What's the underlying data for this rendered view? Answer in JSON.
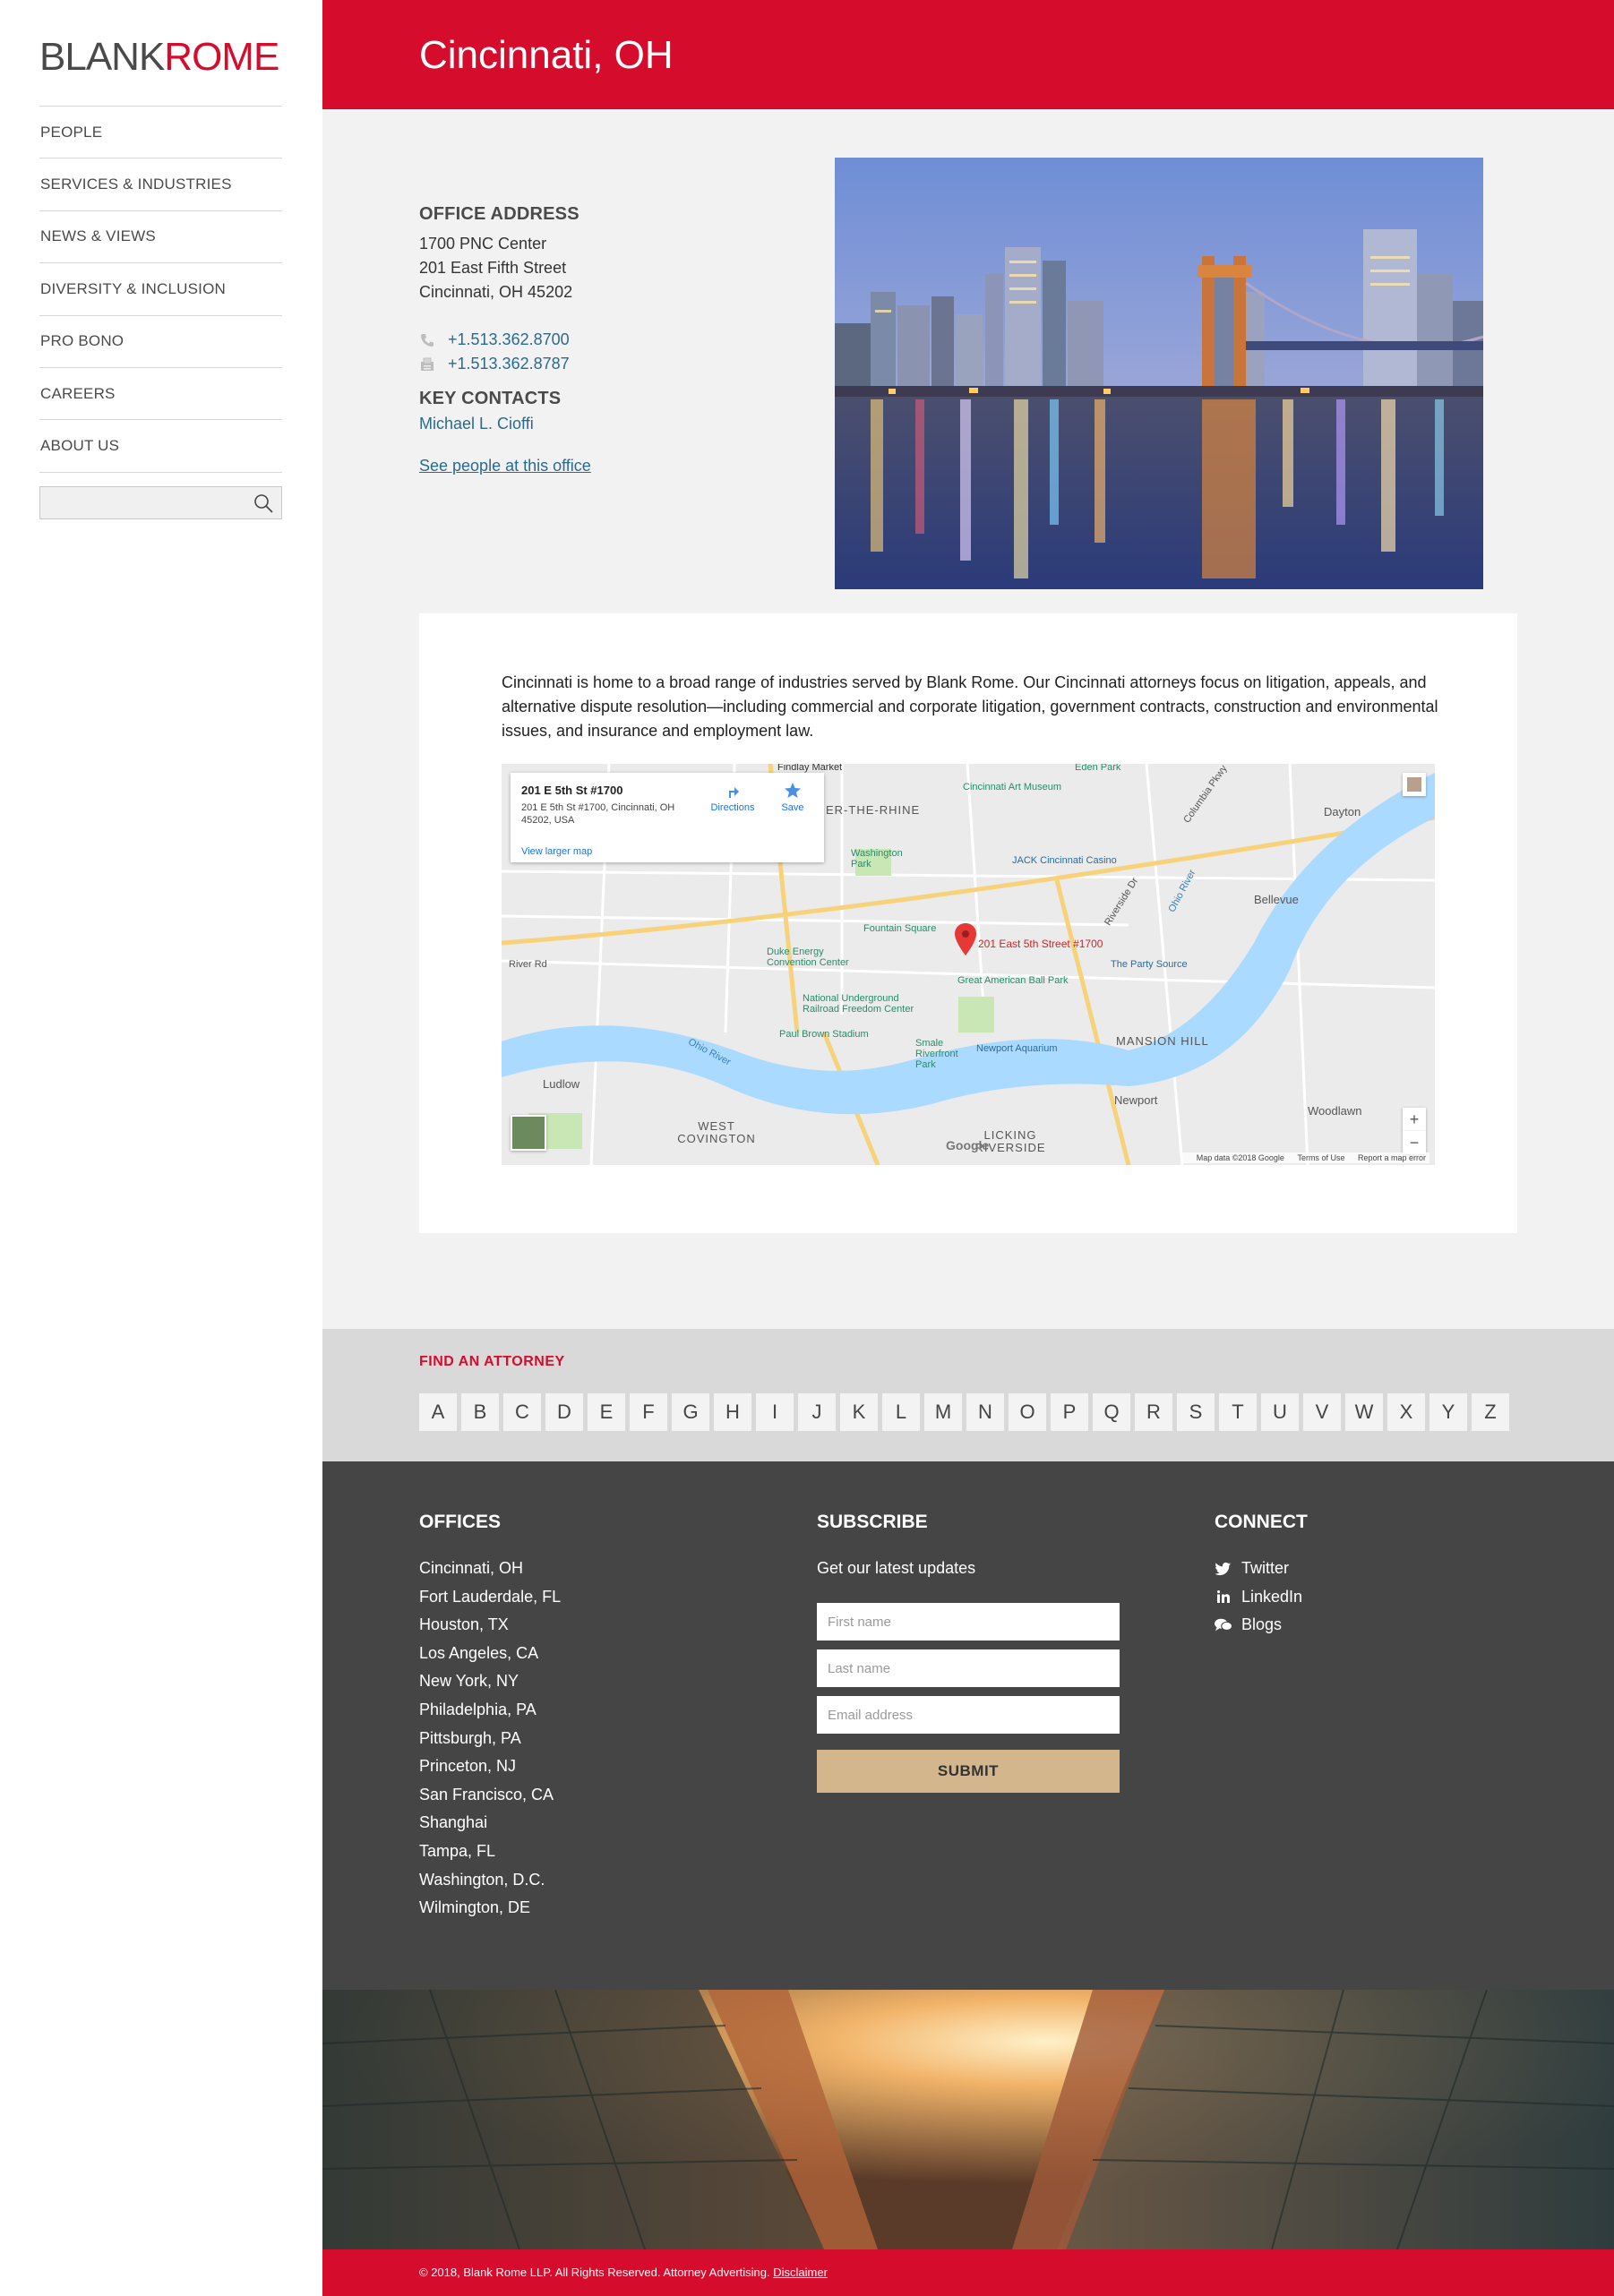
{
  "brand": {
    "part1": "BLANK",
    "part2": "ROME",
    "accent": "#d50c2c"
  },
  "nav": [
    {
      "label": "PEOPLE"
    },
    {
      "label": "SERVICES & INDUSTRIES"
    },
    {
      "label": "NEWS & VIEWS"
    },
    {
      "label": "DIVERSITY & INCLUSION"
    },
    {
      "label": "PRO BONO"
    },
    {
      "label": "CAREERS"
    },
    {
      "label": "ABOUT US"
    }
  ],
  "search": {
    "placeholder": "",
    "icon": "search-icon"
  },
  "page": {
    "title": "Cincinnati, OH"
  },
  "office": {
    "address_heading": "OFFICE ADDRESS",
    "address_lines": [
      "1700 PNC Center",
      "201 East Fifth Street",
      "Cincinnati, OH 45202"
    ],
    "phone": "+1.513.362.8700",
    "fax": "+1.513.362.8787",
    "contacts_heading": "KEY CONTACTS",
    "contact_name": "Michael L. Cioffi",
    "people_link": "See people at this office"
  },
  "description": "Cincinnati is home to a broad range of industries served by Blank Rome. Our Cincinnati attorneys focus on litigation, appeals, and alternative dispute resolution—including commercial and corporate litigation, government contracts, construction and environmental issues, and insurance and employment law.",
  "map": {
    "card_title": "201 E 5th St #1700",
    "card_address": "201 E 5th St #1700, Cincinnati, OH 45202, USA",
    "view_larger": "View larger map",
    "directions": "Directions",
    "save": "Save",
    "pin_label": "201 East 5th Street #1700",
    "google": "Google",
    "map_data": "Map data ©2018 Google",
    "terms": "Terms of Use",
    "report": "Report a map error",
    "labels": {
      "findlay": "Findlay Market",
      "otr": "ER-THE-RHINE",
      "art_museum": "Cincinnati Art Museum",
      "eden_park": "Eden Park",
      "dayton": "Dayton",
      "washington_park": "Washington Park",
      "casino": "JACK Cincinnati Casino",
      "bellevue": "Bellevue",
      "fountain_square": "Fountain Square",
      "duke_energy": "Duke Energy Convention Center",
      "ballpark": "Great American Ball Park",
      "party_source": "The Party Source",
      "freedom_center": "National Underground Railroad Freedom Center",
      "paul_brown": "Paul Brown Stadium",
      "riverfront": "Smale Riverfront Park",
      "aquarium": "Newport Aquarium",
      "mansion_hill": "MANSION HILL",
      "river_rd": "River Rd",
      "ohio_river": "Ohio River",
      "ludlow": "Ludlow",
      "west_covington": "WEST COVINGTON",
      "newport": "Newport",
      "licking_riverside": "LICKING RIVERSIDE",
      "woodlawn": "Woodlawn",
      "ohio_river_2": "Ohio River",
      "columbia_pkwy": "Columbia Pkwy",
      "riverside_dr": "Riverside Dr"
    }
  },
  "find_attorney": {
    "title": "FIND AN ATTORNEY",
    "letters": [
      "A",
      "B",
      "C",
      "D",
      "E",
      "F",
      "G",
      "H",
      "I",
      "J",
      "K",
      "L",
      "M",
      "N",
      "O",
      "P",
      "Q",
      "R",
      "S",
      "T",
      "U",
      "V",
      "W",
      "X",
      "Y",
      "Z"
    ]
  },
  "footer": {
    "offices_title": "OFFICES",
    "offices": [
      "Cincinnati, OH",
      "Fort Lauderdale, FL",
      "Houston, TX",
      "Los Angeles, CA",
      "New York, NY",
      "Philadelphia, PA",
      "Pittsburgh, PA",
      "Princeton, NJ",
      "San Francisco, CA",
      "Shanghai",
      "Tampa, FL",
      "Washington, D.C.",
      "Wilmington, DE"
    ],
    "subscribe_title": "SUBSCRIBE",
    "subscribe_sub": "Get our latest updates",
    "first_name_placeholder": "First name",
    "last_name_placeholder": "Last name",
    "email_placeholder": "Email address",
    "submit_label": "SUBMIT",
    "connect_title": "CONNECT",
    "connect": [
      {
        "label": "Twitter",
        "icon": "twitter-icon"
      },
      {
        "label": "LinkedIn",
        "icon": "linkedin-icon"
      },
      {
        "label": "Blogs",
        "icon": "chat-bubbles-icon"
      }
    ]
  },
  "legal": {
    "text": "© 2018, Blank Rome LLP. All Rights Reserved. Attorney Advertising.",
    "disclaimer": "Disclaimer"
  }
}
